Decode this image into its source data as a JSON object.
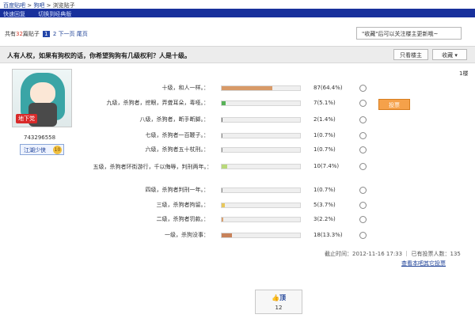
{
  "breadcrumb": {
    "root": "百度贴吧",
    "sep": ">",
    "bar": "狗吧",
    "page": "浏览贴子"
  },
  "topbar": {
    "quick_reply": "快速回复",
    "switch_mode": "切换到经典版"
  },
  "pager": {
    "prefix": "共有",
    "count": "32",
    "suffix": "篇贴子",
    "page1": "1",
    "page2": "2",
    "next": "下一页",
    "last": "尾页"
  },
  "notice": "\"收藏\"后可以关注楼主更新哦~",
  "thread": {
    "title": "人有人权，如果有狗权的话，你希望狗狗有几级权利？人是十级。",
    "only_op": "只看楼主",
    "favorite": "收藏"
  },
  "floor": "1楼",
  "user": {
    "tag": "地下党",
    "id": "743296558",
    "rank": "江湖少侠",
    "level": "10"
  },
  "poll": {
    "vote_button": "投票",
    "options": [
      {
        "label": "十级，和人一样。：",
        "value": "87(64.4%)",
        "pct": 64.4,
        "color": "#d89a68"
      },
      {
        "label": "九级，杀狗者，挖眼，弄聋耳朵，毒哑。：",
        "value": "7(5.1%)",
        "pct": 5.1,
        "color": "#57b257"
      },
      {
        "label": "八级，杀狗者，断手断脚。：",
        "value": "2(1.4%)",
        "pct": 1.4,
        "color": "#666666"
      },
      {
        "label": "七级，杀狗者一百鞭子。：",
        "value": "1(0.7%)",
        "pct": 0.7,
        "color": "#888888"
      },
      {
        "label": "六级，杀狗者五十杖刑。：",
        "value": "1(0.7%)",
        "pct": 0.7,
        "color": "#888888"
      },
      {
        "label": "五级，杀狗者环街游行，千以侮辱，判刑两年。：",
        "value": "10(7.4%)",
        "pct": 7.4,
        "color": "#b9d97a"
      },
      {
        "label": "四级，杀狗者判刑一年。：",
        "value": "1(0.7%)",
        "pct": 0.7,
        "color": "#888888"
      },
      {
        "label": "三级，杀狗者拘留。：",
        "value": "5(3.7%)",
        "pct": 3.7,
        "color": "#e8c85a"
      },
      {
        "label": "二级，杀狗者罚款。：",
        "value": "3(2.2%)",
        "pct": 2.2,
        "color": "#d8a070"
      },
      {
        "label": "一级，杀狗没事：",
        "value": "18(13.3%)",
        "pct": 13.3,
        "color": "#c8825a"
      }
    ],
    "deadline": "截止时间：2012-11-16 17:33  ｜  已有投票人数：135",
    "others": "查看本吧其它投票"
  },
  "ding": {
    "label": "顶",
    "count": "12"
  }
}
